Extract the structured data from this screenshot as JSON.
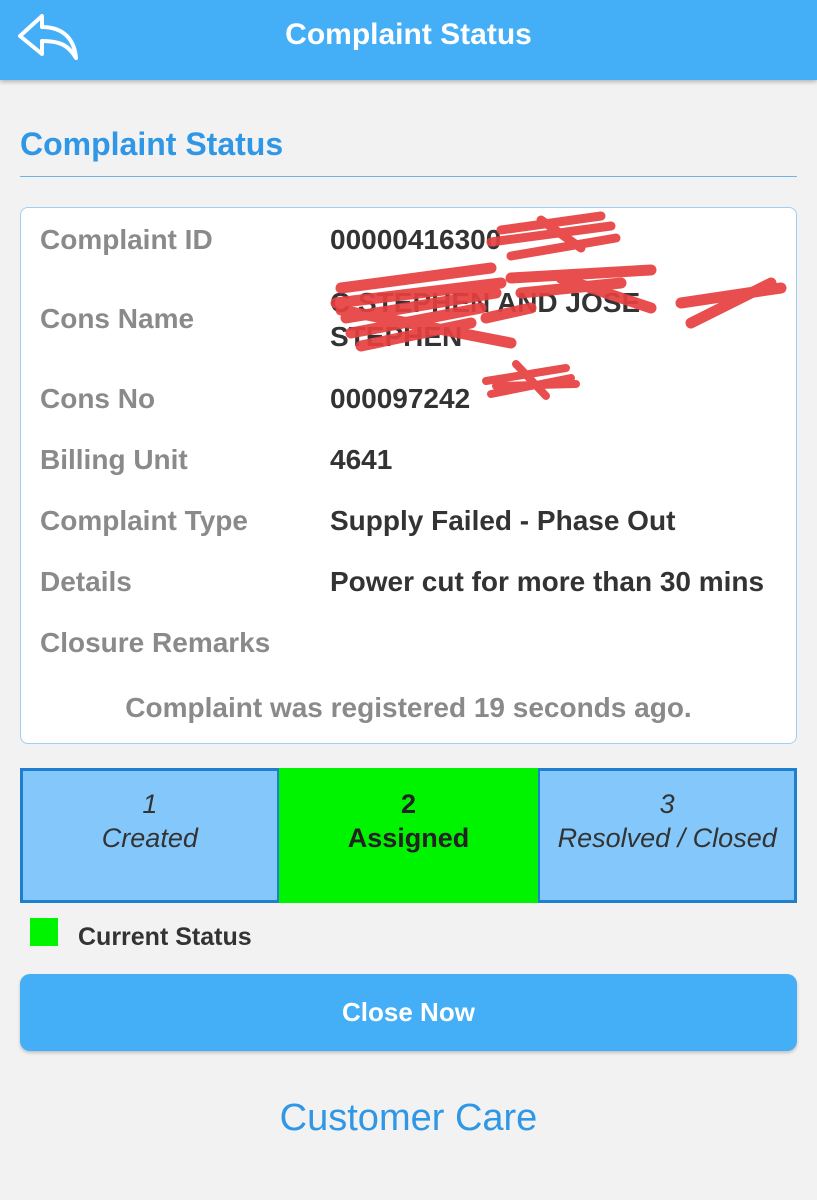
{
  "header": {
    "title": "Complaint Status",
    "back_icon": "back-arrow-icon"
  },
  "section_title": "Complaint Status",
  "details": {
    "complaint_id": {
      "label": "Complaint ID",
      "value": "00000416300"
    },
    "cons_name": {
      "label": "Cons Name",
      "value_line1": "C          STEPHEN AND JOSE",
      "value_line2": "STEPHEN"
    },
    "cons_no": {
      "label": "Cons No",
      "value": "000097242"
    },
    "billing_unit": {
      "label": "Billing Unit",
      "value": "4641"
    },
    "complaint_type": {
      "label": "Complaint Type",
      "value": "Supply Failed - Phase Out"
    },
    "details": {
      "label": "Details",
      "value": "Power cut for more than 30 mins"
    },
    "closure_remarks": {
      "label": "Closure Remarks",
      "value": ""
    },
    "registered_note": "Complaint was registered 19 seconds ago."
  },
  "steps": [
    {
      "number": "1",
      "label": "Created",
      "current": false
    },
    {
      "number": "2",
      "label": "Assigned",
      "current": true
    },
    {
      "number": "3",
      "label": "Resolved / Closed",
      "current": false
    }
  ],
  "legend": {
    "label": "Current Status",
    "color": "#00f400"
  },
  "close_button": "Close Now",
  "customer_care": "Customer Care",
  "colors": {
    "app_bar": "#44aef6",
    "accent": "#2f97e6",
    "step_default": "#84c8fb",
    "step_current": "#00f400",
    "redaction": "#e84040"
  }
}
